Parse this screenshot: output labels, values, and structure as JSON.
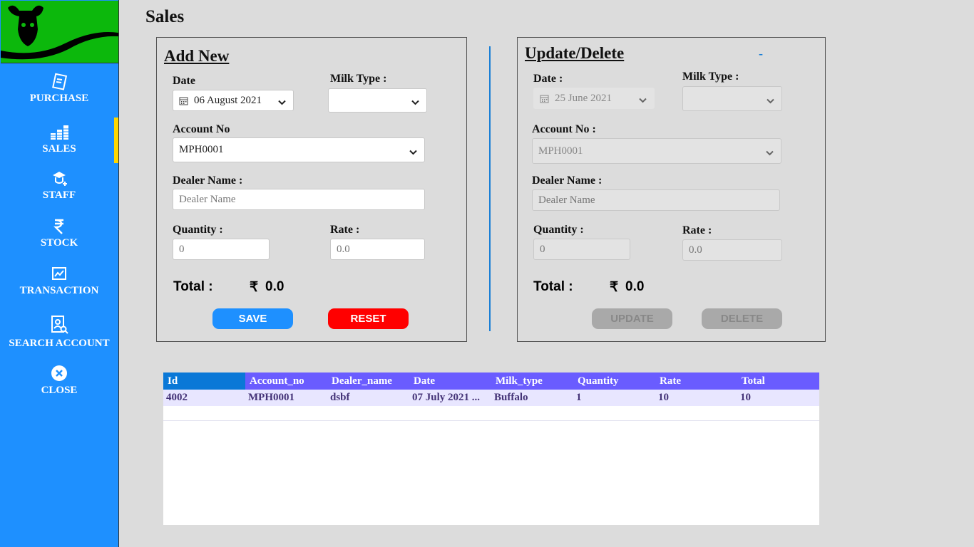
{
  "colors": {
    "sidebar": "#1e90ff",
    "logo_bg": "#0cb80c",
    "active_marker": "#ffd700",
    "save": "#1e90ff",
    "reset": "#ff0000",
    "disabled": "#a9a9a9",
    "table_header": "#6a5cff",
    "table_id_header": "#0a78d7",
    "separator": "#1a7fd6"
  },
  "sidebar": {
    "items": [
      {
        "label": "PURCHASE",
        "icon": "receipt-icon"
      },
      {
        "label": "SALES",
        "icon": "coins-icon"
      },
      {
        "label": "STAFF",
        "icon": "staff-icon"
      },
      {
        "label": "STOCK",
        "icon": "rupee-icon"
      },
      {
        "label": "TRANSACTION",
        "icon": "chart-icon"
      },
      {
        "label": "SEARCH ACCOUNT",
        "icon": "search-account-icon"
      },
      {
        "label": "CLOSE",
        "icon": "close-icon"
      }
    ],
    "active": "SALES"
  },
  "page": {
    "title": "Sales"
  },
  "add_new": {
    "title": "Add New",
    "date_label": "Date",
    "date_value": "06 August 2021",
    "milk_type_label": "Milk Type :",
    "milk_type_value": "",
    "account_label": "Account No",
    "account_value": "MPH0001",
    "dealer_label": "Dealer Name :",
    "dealer_placeholder": "Dealer Name",
    "quantity_label": "Quantity :",
    "quantity_value": "0",
    "rate_label": "Rate :",
    "rate_value": "0.0",
    "total_label": "Total :",
    "currency": "₹",
    "total_value": "0.0",
    "save_label": "SAVE",
    "reset_label": "RESET"
  },
  "update_delete": {
    "title": "Update/Delete",
    "dash": "-",
    "date_label": "Date :",
    "date_value": "25 June 2021",
    "milk_type_label": "Milk Type :",
    "milk_type_value": "",
    "account_label": "Account No :",
    "account_value": "MPH0001",
    "dealer_label": "Dealer Name :",
    "dealer_placeholder": "Dealer Name",
    "quantity_label": "Quantity :",
    "quantity_value": "0",
    "rate_label": "Rate :",
    "rate_value": "0.0",
    "total_label": "Total :",
    "currency": "₹",
    "total_value": "0.0",
    "update_label": "UPDATE",
    "delete_label": "DELETE"
  },
  "table": {
    "columns": [
      "Id",
      "Account_no",
      "Dealer_name",
      "Date",
      "Milk_type",
      "Quantity",
      "Rate",
      "Total"
    ],
    "rows": [
      [
        "4002",
        "MPH0001",
        "dsbf",
        "07 July 2021  ...",
        "Buffalo",
        "1",
        "10",
        "10"
      ]
    ]
  }
}
